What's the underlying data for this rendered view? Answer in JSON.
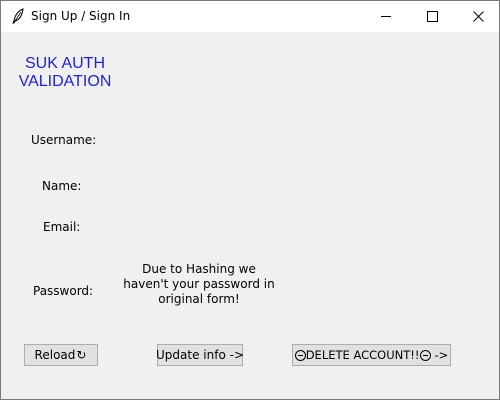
{
  "window": {
    "title": "Sign Up / Sign In",
    "controls": {
      "minimize": "minimize",
      "maximize": "maximize",
      "close": "close"
    }
  },
  "heading": {
    "line1": "SUK AUTH",
    "line2": "VALIDATION",
    "color": "#1f1fe0"
  },
  "form": {
    "username_label": "Username:",
    "name_label": "Name:",
    "email_label": "Email:",
    "password_label": "Password:",
    "hash_note": "Due to Hashing we haven't your password in original form!"
  },
  "buttons": {
    "reload_label": "Reload",
    "reload_icon": "↻",
    "update_label": "Update info ->",
    "delete_label": "DELETE ACCOUNT!!",
    "delete_suffix": "->"
  },
  "icons": [
    "feather-icon",
    "reload-icon",
    "circle-minus-icon"
  ]
}
